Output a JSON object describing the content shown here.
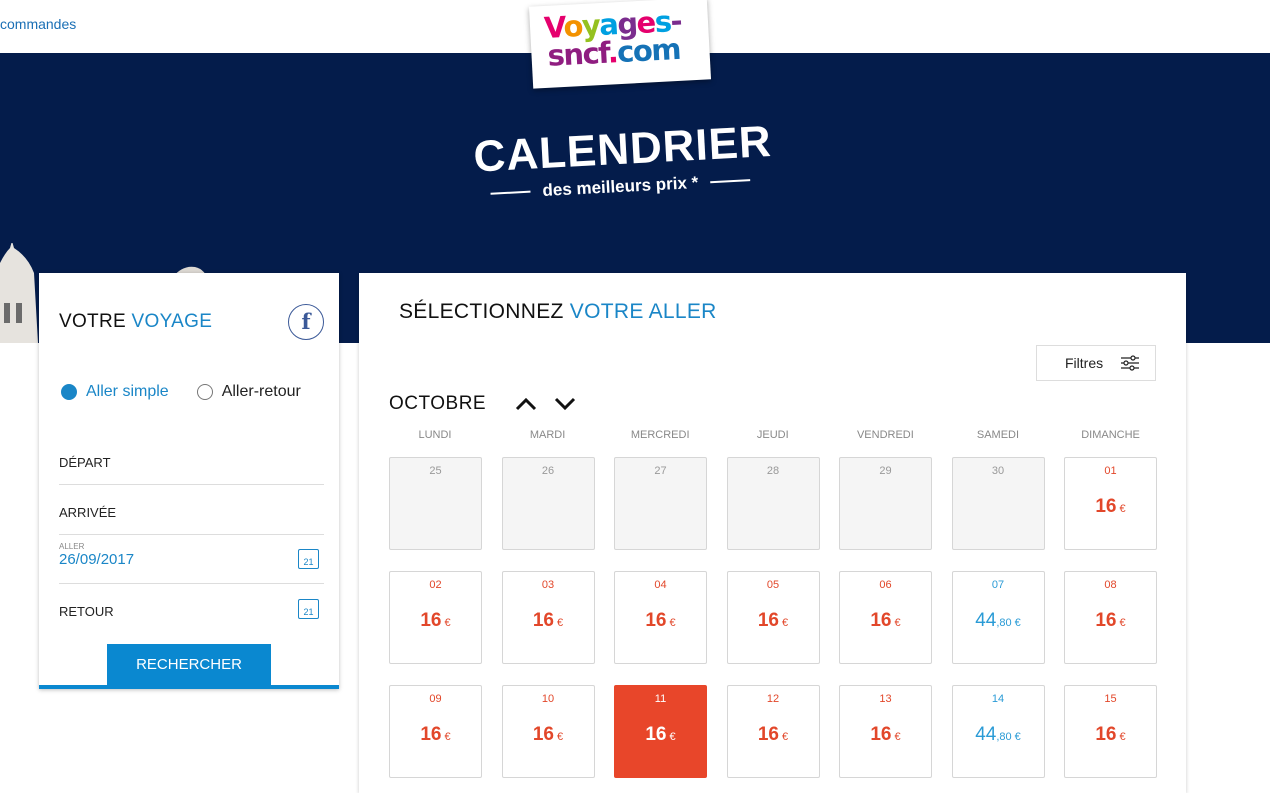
{
  "topbar": {
    "orders_link": "commandes"
  },
  "logo": {
    "line1": [
      "V",
      "o",
      "y",
      "a",
      "g",
      "e",
      "s",
      "-"
    ],
    "line2_part1": "sncf",
    "line2_dot": ".",
    "line2_part2": "com"
  },
  "hero": {
    "title": "CALENDRIER",
    "subtitle": "des meilleurs prix *"
  },
  "voyage": {
    "title_black": "VOTRE",
    "title_blue": "VOYAGE",
    "facebook_label": "f",
    "trip_types": [
      {
        "label": "Aller simple",
        "selected": true
      },
      {
        "label": "Aller-retour",
        "selected": false
      }
    ],
    "depart_label": "DÉPART",
    "arrivee_label": "ARRIVÉE",
    "aller_small": "ALLER",
    "aller_value": "26/09/2017",
    "retour_label": "RETOUR",
    "calendar_icon_text": "21",
    "search_button": "RECHERCHER"
  },
  "calendar": {
    "title_black": "SÉLECTIONNEZ",
    "title_blue": "VOTRE ALLER",
    "filters_label": "Filtres",
    "month": "OCTOBRE",
    "weekdays": [
      "LUNDI",
      "MARDI",
      "MERCREDI",
      "JEUDI",
      "VENDREDI",
      "SAMEDI",
      "DIMANCHE"
    ],
    "currency": "€",
    "cells": [
      {
        "day": "25",
        "state": "empty"
      },
      {
        "day": "26",
        "state": "empty"
      },
      {
        "day": "27",
        "state": "empty"
      },
      {
        "day": "28",
        "state": "empty"
      },
      {
        "day": "29",
        "state": "empty"
      },
      {
        "day": "30",
        "state": "empty"
      },
      {
        "day": "01",
        "price": "16",
        "cents": "",
        "state": "red"
      },
      {
        "day": "02",
        "price": "16",
        "cents": "",
        "state": "red"
      },
      {
        "day": "03",
        "price": "16",
        "cents": "",
        "state": "red"
      },
      {
        "day": "04",
        "price": "16",
        "cents": "",
        "state": "red"
      },
      {
        "day": "05",
        "price": "16",
        "cents": "",
        "state": "red"
      },
      {
        "day": "06",
        "price": "16",
        "cents": "",
        "state": "red"
      },
      {
        "day": "07",
        "price": "44",
        "cents": ",80",
        "state": "blue"
      },
      {
        "day": "08",
        "price": "16",
        "cents": "",
        "state": "red"
      },
      {
        "day": "09",
        "price": "16",
        "cents": "",
        "state": "red"
      },
      {
        "day": "10",
        "price": "16",
        "cents": "",
        "state": "red"
      },
      {
        "day": "11",
        "price": "16",
        "cents": "",
        "state": "selected"
      },
      {
        "day": "12",
        "price": "16",
        "cents": "",
        "state": "red"
      },
      {
        "day": "13",
        "price": "16",
        "cents": "",
        "state": "red"
      },
      {
        "day": "14",
        "price": "44",
        "cents": ",80",
        "state": "blue"
      },
      {
        "day": "15",
        "price": "16",
        "cents": "",
        "state": "red"
      }
    ]
  },
  "colors": {
    "navy": "#041c4b",
    "accent_blue": "#1a86c7",
    "price_red": "#e2472a"
  }
}
